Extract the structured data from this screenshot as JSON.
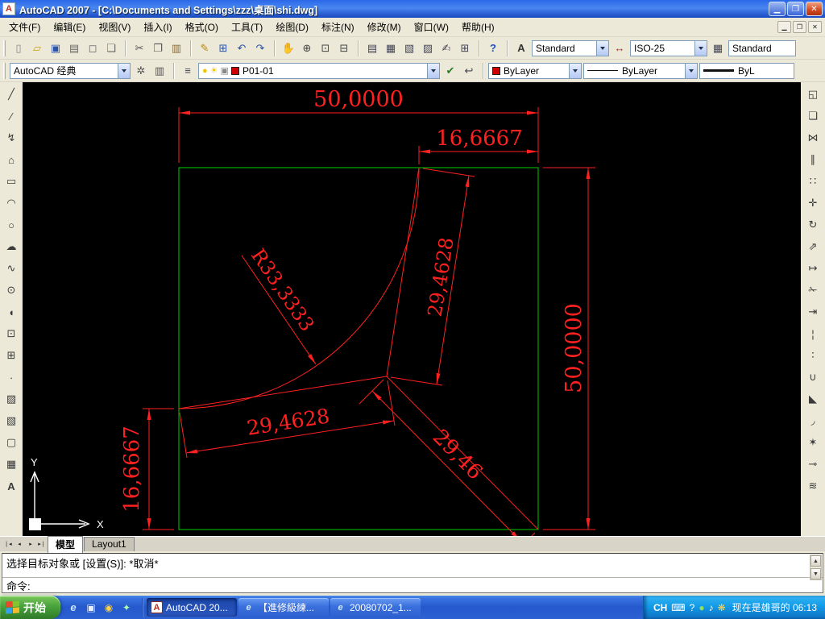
{
  "colors": {
    "title-blue-1": "#2a68e8",
    "title-blue-2": "#1748c0",
    "chrome-gray": "#ece9d8",
    "combo-border": "#7f9db9",
    "canvas-bg": "#000000",
    "dim-red": "#ff2020",
    "rect-green": "#00cc00",
    "layer-red": "#d00000",
    "taskbar-blue-1": "#4a8ae8",
    "taskbar-blue-2": "#2458cc",
    "tray-blue": "#129be8",
    "start-green": "#48a33c",
    "flag-red": "#e8482c",
    "flag-green": "#84c42c",
    "flag-blue": "#34a0e8",
    "flag-yellow": "#f0bc2c"
  },
  "titlebar": {
    "title": "AutoCAD 2007 - [C:\\Documents and Settings\\zzz\\桌面\\shi.dwg]",
    "app_icon_letter": "A",
    "buttons": [
      {
        "name": "minimize-button",
        "glyph": "▁",
        "cls": "wbtn"
      },
      {
        "name": "restore-button",
        "glyph": "❐",
        "cls": "wbtn"
      },
      {
        "name": "close-button",
        "glyph": "✕",
        "cls": "wbtn close"
      }
    ]
  },
  "menubar": {
    "items": [
      {
        "name": "menu-file",
        "label": "文件(F)"
      },
      {
        "name": "menu-edit",
        "label": "编辑(E)"
      },
      {
        "name": "menu-view",
        "label": "视图(V)"
      },
      {
        "name": "menu-insert",
        "label": "插入(I)"
      },
      {
        "name": "menu-format",
        "label": "格式(O)"
      },
      {
        "name": "menu-tools",
        "label": "工具(T)"
      },
      {
        "name": "menu-draw",
        "label": "绘图(D)"
      },
      {
        "name": "menu-dimension",
        "label": "标注(N)"
      },
      {
        "name": "menu-modify",
        "label": "修改(M)"
      },
      {
        "name": "menu-window",
        "label": "窗口(W)"
      },
      {
        "name": "menu-help",
        "label": "帮助(H)"
      }
    ],
    "mdi_buttons": [
      {
        "name": "mdi-minimize-button",
        "glyph": "▁"
      },
      {
        "name": "mdi-restore-button",
        "glyph": "❐"
      },
      {
        "name": "mdi-close-button",
        "glyph": "✕"
      }
    ]
  },
  "toolbar1": {
    "groups": [
      [
        {
          "name": "new-icon",
          "glyph": "▯",
          "css": "color:#888"
        },
        {
          "name": "open-icon",
          "glyph": "▱",
          "css": "color:#d09c10"
        },
        {
          "name": "save-icon",
          "glyph": "▣",
          "css": "color:#2b53a8"
        },
        {
          "name": "plot-icon",
          "glyph": "▤",
          "css": "color:#666"
        },
        {
          "name": "plot-preview-icon",
          "glyph": "◻",
          "css": "color:#666"
        },
        {
          "name": "publish-icon",
          "glyph": "❏",
          "css": "color:#666"
        }
      ],
      [
        {
          "name": "cut-icon",
          "glyph": "✂",
          "css": "color:#555"
        },
        {
          "name": "copy-icon",
          "glyph": "❐",
          "css": "color:#555"
        },
        {
          "name": "paste-icon",
          "glyph": "▥",
          "css": "color:#8a6d3b"
        }
      ],
      [
        {
          "name": "match-properties-icon",
          "glyph": "✎",
          "css": "color:#b8860b"
        },
        {
          "name": "block-editor-icon",
          "glyph": "⊞",
          "css": "color:#2b53a8"
        },
        {
          "name": "undo-icon",
          "glyph": "↶",
          "css": "color:#2b53a8"
        },
        {
          "name": "redo-icon",
          "glyph": "↷",
          "css": "color:#2b53a8"
        }
      ],
      [
        {
          "name": "pan-icon",
          "glyph": "✋",
          "css": "color:#c87a2a"
        },
        {
          "name": "zoom-realtime-icon",
          "glyph": "⊕",
          "css": "color:#444"
        },
        {
          "name": "zoom-window-icon",
          "glyph": "⊡",
          "css": "color:#444"
        },
        {
          "name": "zoom-previous-icon",
          "glyph": "⊟",
          "css": "color:#444"
        }
      ],
      [
        {
          "name": "properties-icon",
          "glyph": "▤",
          "css": "color:#445"
        },
        {
          "name": "designcenter-icon",
          "glyph": "▦",
          "css": "color:#445"
        },
        {
          "name": "tool-palettes-icon",
          "glyph": "▧",
          "css": "color:#445"
        },
        {
          "name": "sheetset-manager-icon",
          "glyph": "▨",
          "css": "color:#445"
        },
        {
          "name": "markup-icon",
          "glyph": "✍",
          "css": "color:#445"
        },
        {
          "name": "quickcalc-icon",
          "glyph": "⊞",
          "css": "color:#445"
        }
      ],
      [
        {
          "name": "help-icon",
          "glyph": "?",
          "css": "color:#1a50c8;font-weight:bold"
        }
      ]
    ],
    "text_style_icon": "A",
    "text_style": "Standard",
    "dim_style_icon": "↔",
    "dim_style": "ISO-25",
    "table_style_icon": "▦",
    "table_style": "Standard"
  },
  "toolbar2": {
    "workspace": "AutoCAD 经典",
    "ws_icons": [
      {
        "name": "workspace-settings-icon",
        "glyph": "✲",
        "css": "color:#555"
      },
      {
        "name": "workspace-save-icon",
        "glyph": "▥",
        "css": "color:#555"
      }
    ],
    "layer_manager_icon": "≡",
    "layer_icons": [
      "●",
      "☀",
      "▣"
    ],
    "layer": "P01-01",
    "layer_tool_icons": [
      {
        "name": "make-layer-current-icon",
        "glyph": "✔",
        "css": "color:#2a7a2a"
      },
      {
        "name": "layer-previous-icon",
        "glyph": "↩",
        "css": "color:#445"
      }
    ],
    "color": "ByLayer",
    "linetype": "ByLayer",
    "lineweight": "ByL"
  },
  "left_toolbar": [
    {
      "name": "line-icon",
      "glyph": "╱"
    },
    {
      "name": "construction-line-icon",
      "glyph": "⁄"
    },
    {
      "name": "polyline-icon",
      "glyph": "↯"
    },
    {
      "name": "polygon-icon",
      "glyph": "⌂"
    },
    {
      "name": "rectangle-icon",
      "glyph": "▭"
    },
    {
      "name": "arc-icon",
      "glyph": "◠"
    },
    {
      "name": "circle-icon",
      "glyph": "○"
    },
    {
      "name": "revcloud-icon",
      "glyph": "☁"
    },
    {
      "name": "spline-icon",
      "glyph": "∿"
    },
    {
      "name": "ellipse-icon",
      "glyph": "⊙"
    },
    {
      "name": "ellipse-arc-icon",
      "glyph": "◖"
    },
    {
      "name": "insert-block-icon",
      "glyph": "⊡"
    },
    {
      "name": "make-block-icon",
      "glyph": "⊞"
    },
    {
      "name": "point-icon",
      "glyph": "∙"
    },
    {
      "name": "hatch-icon",
      "glyph": "▨"
    },
    {
      "name": "gradient-icon",
      "glyph": "▧"
    },
    {
      "name": "region-icon",
      "glyph": "▢"
    },
    {
      "name": "table-icon",
      "glyph": "▦"
    },
    {
      "name": "mtext-icon",
      "glyph": "A",
      "css": "font-weight:bold"
    }
  ],
  "right_toolbar": [
    {
      "name": "erase-icon",
      "glyph": "◱"
    },
    {
      "name": "copy-object-icon",
      "glyph": "❏"
    },
    {
      "name": "mirror-icon",
      "glyph": "⋈"
    },
    {
      "name": "offset-icon",
      "glyph": "∥"
    },
    {
      "name": "array-icon",
      "glyph": "∷"
    },
    {
      "name": "move-icon",
      "glyph": "✛"
    },
    {
      "name": "rotate-icon",
      "glyph": "↻"
    },
    {
      "name": "scale-icon",
      "glyph": "⇗"
    },
    {
      "name": "stretch-icon",
      "glyph": "↦"
    },
    {
      "name": "trim-icon",
      "glyph": "✁"
    },
    {
      "name": "extend-icon",
      "glyph": "⇥"
    },
    {
      "name": "break-at-point-icon",
      "glyph": "¦"
    },
    {
      "name": "break-icon",
      "glyph": "∶"
    },
    {
      "name": "join-icon",
      "glyph": "∪"
    },
    {
      "name": "chamfer-icon",
      "glyph": "◣"
    },
    {
      "name": "fillet-icon",
      "glyph": "◞"
    },
    {
      "name": "explode-icon",
      "glyph": "✶"
    },
    {
      "name": "lengthen-icon",
      "glyph": "⊸"
    },
    {
      "name": "align-icon",
      "glyph": "≋"
    }
  ],
  "canvas": {
    "dims": {
      "top": "50,0000",
      "top_right": "16,6667",
      "right": "50,0000",
      "left": "16,6667",
      "seg_steep": "29,4628",
      "seg_flat": "29,4628",
      "seg_diag": "29,46",
      "radius": "R33,3333"
    },
    "ucs": {
      "x": "X",
      "y": "Y"
    }
  },
  "tabs": {
    "nav": [
      {
        "name": "tab-nav-first",
        "glyph": "❘◂"
      },
      {
        "name": "tab-nav-prev",
        "glyph": "◂"
      },
      {
        "name": "tab-nav-next",
        "glyph": "▸"
      },
      {
        "name": "tab-nav-last",
        "glyph": "▸❘"
      }
    ],
    "model": "模型",
    "layout": "Layout1"
  },
  "command": {
    "history_line": "选择目标对象或 [设置(S)]: *取消*",
    "prompt_line": "命令:",
    "scroll_up": "▲",
    "scroll_down": "▼"
  },
  "taskbar": {
    "start_label": "开始",
    "quick_launch": [
      {
        "name": "quick-launch-ie-icon",
        "glyph": "e",
        "css": "color:#cfe8ff;font-style:italic;font-weight:bold;font-size:13px"
      },
      {
        "name": "quick-launch-desktop-icon",
        "glyph": "▣",
        "css": "color:#e8f0ff"
      },
      {
        "name": "quick-launch-media-icon",
        "glyph": "◉",
        "css": "color:#ffd24a"
      },
      {
        "name": "quick-launch-messenger-icon",
        "glyph": "✦",
        "css": "color:#b0ffb0"
      }
    ],
    "tasks": [
      {
        "name": "task-autocad",
        "label": "AutoCAD 20...",
        "glyph": "A",
        "icss": "background:#fff;color:#c42a1c;border:1px solid #8a2a1c",
        "cls": "task active"
      },
      {
        "name": "task-ie-1",
        "label": "【進修級練...",
        "glyph": "e",
        "icss": "color:#cfe8ff;font-style:italic",
        "cls": "task"
      },
      {
        "name": "task-ie-2",
        "label": "20080702_1...",
        "glyph": "e",
        "icss": "color:#cfe8ff;font-style:italic",
        "cls": "task"
      }
    ],
    "tray": [
      {
        "name": "language-indicator",
        "glyph": "CH",
        "cls": "traytext"
      },
      {
        "name": "keyboard-tray-icon",
        "glyph": "⌨",
        "cls": "trayicon"
      },
      {
        "name": "help-tray-icon",
        "glyph": "?",
        "cls": "trayicon"
      },
      {
        "name": "antivirus-tray-icon",
        "glyph": "●",
        "cls": "trayicon",
        "css": "color:#90e060"
      },
      {
        "name": "volume-tray-icon",
        "glyph": "♪",
        "cls": "trayicon"
      },
      {
        "name": "messenger-tray-icon",
        "glyph": "❋",
        "cls": "trayicon",
        "css": "color:#ffd24a"
      }
    ],
    "clock": "现在是雄哥的 06:13"
  }
}
